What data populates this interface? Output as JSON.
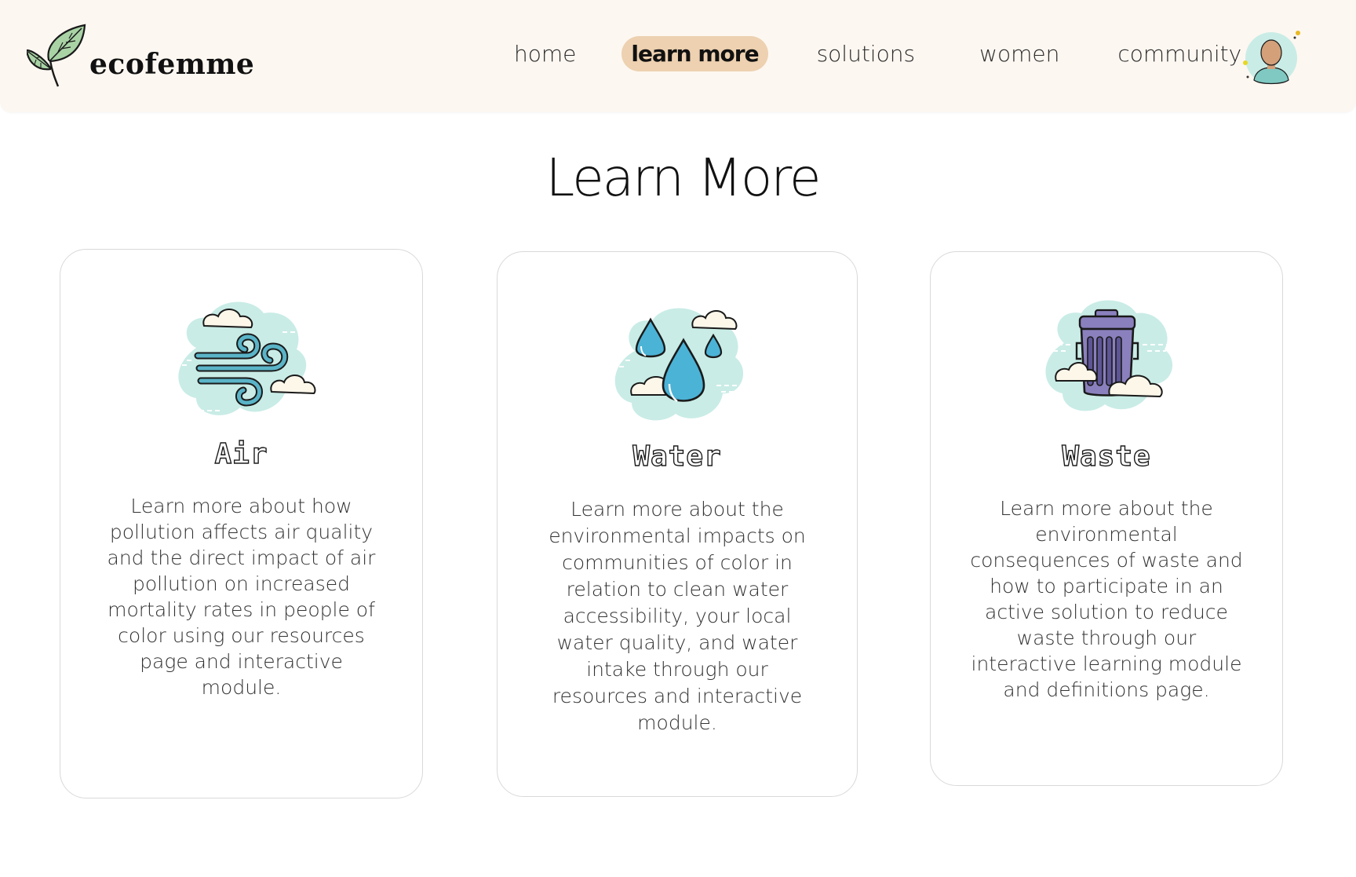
{
  "brand": {
    "name": "ecofemme",
    "logo_icon": "leaf-icon"
  },
  "nav": {
    "items": [
      {
        "label": "home",
        "active": false
      },
      {
        "label": "learn more",
        "active": true
      },
      {
        "label": "solutions",
        "active": false
      },
      {
        "label": "women",
        "active": false
      },
      {
        "label": "community",
        "active": false
      }
    ],
    "active_color": "#edd1b0",
    "avatar_icon": "user-avatar-icon"
  },
  "page": {
    "title": "Learn More"
  },
  "cards": [
    {
      "title": "Air",
      "icon": "wind-icon",
      "description": "Learn more about how pollution affects air quality and the direct impact of air pollution on increased mortality rates in people of color using our resources page and interactive module."
    },
    {
      "title": "Water",
      "icon": "water-drops-icon",
      "description": "Learn more about the environmental impacts on communities of color in relation to clean water accessibility, your local water quality, and water intake through our resources and interactive module."
    },
    {
      "title": "Waste",
      "icon": "trash-can-icon",
      "description": "Learn more about the environmental consequences of waste and how to participate in an active solution to reduce waste through our interactive learning module and definitions page."
    }
  ],
  "colors": {
    "navbar_bg": "#fdf7f1",
    "icon_blob": "#c9ece6",
    "water_blue": "#4bb3d6",
    "trash_purple": "#8a80bd"
  }
}
